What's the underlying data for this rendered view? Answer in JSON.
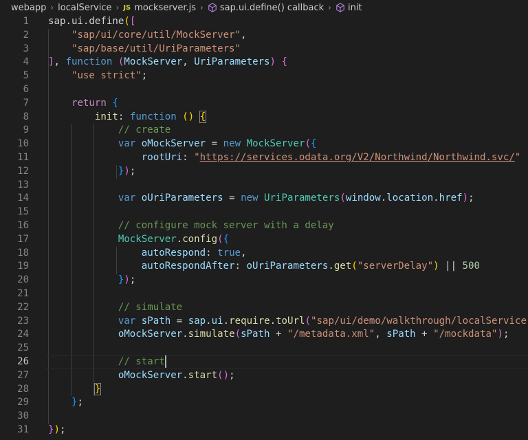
{
  "breadcrumb": {
    "segments": [
      "webapp",
      "localService",
      "mockserver.js",
      "sap.ui.define() callback",
      "init"
    ],
    "file_badge": "JS"
  },
  "editor": {
    "active_line": 26,
    "lines": [
      {
        "n": "1",
        "tokens": [
          [
            "plain",
            "sap.ui.define"
          ],
          [
            "b1",
            "("
          ],
          [
            "b2",
            "["
          ]
        ]
      },
      {
        "n": "2",
        "tokens": [
          [
            "plain",
            "    "
          ],
          [
            "str",
            "\"sap/ui/core/util/MockServer\""
          ],
          [
            "plain",
            ","
          ]
        ]
      },
      {
        "n": "3",
        "tokens": [
          [
            "plain",
            "    "
          ],
          [
            "str",
            "\"sap/base/util/UriParameters\""
          ]
        ]
      },
      {
        "n": "4",
        "tokens": [
          [
            "b2",
            "]"
          ],
          [
            "plain",
            ", "
          ],
          [
            "kw",
            "function"
          ],
          [
            "plain",
            " "
          ],
          [
            "b2",
            "("
          ],
          [
            "var",
            "MockServer"
          ],
          [
            "plain",
            ", "
          ],
          [
            "var",
            "UriParameters"
          ],
          [
            "b2",
            ")"
          ],
          [
            "plain",
            " "
          ],
          [
            "b2",
            "{"
          ]
        ]
      },
      {
        "n": "5",
        "tokens": [
          [
            "plain",
            "    "
          ],
          [
            "str",
            "\"use strict\""
          ],
          [
            "plain",
            ";"
          ]
        ]
      },
      {
        "n": "6",
        "tokens": []
      },
      {
        "n": "7",
        "tokens": [
          [
            "plain",
            "    "
          ],
          [
            "ctrl",
            "return"
          ],
          [
            "plain",
            " "
          ],
          [
            "b3",
            "{"
          ]
        ]
      },
      {
        "n": "8",
        "tokens": [
          [
            "plain",
            "        "
          ],
          [
            "fn",
            "init"
          ],
          [
            "plain",
            ": "
          ],
          [
            "kw",
            "function"
          ],
          [
            "plain",
            " "
          ],
          [
            "b1",
            "()"
          ],
          [
            "plain",
            " "
          ],
          [
            "bm",
            "{"
          ]
        ]
      },
      {
        "n": "9",
        "tokens": [
          [
            "plain",
            "            "
          ],
          [
            "com",
            "// create"
          ]
        ]
      },
      {
        "n": "10",
        "tokens": [
          [
            "plain",
            "            "
          ],
          [
            "kw",
            "var"
          ],
          [
            "plain",
            " "
          ],
          [
            "var",
            "oMockServer"
          ],
          [
            "plain",
            " = "
          ],
          [
            "kw",
            "new"
          ],
          [
            "plain",
            " "
          ],
          [
            "type",
            "MockServer"
          ],
          [
            "b2",
            "("
          ],
          [
            "b3",
            "{"
          ]
        ]
      },
      {
        "n": "11",
        "tokens": [
          [
            "plain",
            "                "
          ],
          [
            "var",
            "rootUri"
          ],
          [
            "plain",
            ": "
          ],
          [
            "str",
            "\""
          ],
          [
            "stru",
            "https://services.odata.org/V2/Northwind/Northwind.svc/"
          ],
          [
            "str",
            "\""
          ]
        ]
      },
      {
        "n": "12",
        "tokens": [
          [
            "plain",
            "            "
          ],
          [
            "b3",
            "}"
          ],
          [
            "b2",
            ")"
          ],
          [
            "plain",
            ";"
          ]
        ]
      },
      {
        "n": "13",
        "tokens": []
      },
      {
        "n": "14",
        "tokens": [
          [
            "plain",
            "            "
          ],
          [
            "kw",
            "var"
          ],
          [
            "plain",
            " "
          ],
          [
            "var",
            "oUriParameters"
          ],
          [
            "plain",
            " = "
          ],
          [
            "kw",
            "new"
          ],
          [
            "plain",
            " "
          ],
          [
            "type",
            "UriParameters"
          ],
          [
            "b2",
            "("
          ],
          [
            "var",
            "window"
          ],
          [
            "plain",
            "."
          ],
          [
            "var",
            "location"
          ],
          [
            "plain",
            "."
          ],
          [
            "var",
            "href"
          ],
          [
            "b2",
            ")"
          ],
          [
            "plain",
            ";"
          ]
        ]
      },
      {
        "n": "15",
        "tokens": []
      },
      {
        "n": "16",
        "tokens": [
          [
            "plain",
            "            "
          ],
          [
            "com",
            "// configure mock server with a delay"
          ]
        ]
      },
      {
        "n": "17",
        "tokens": [
          [
            "plain",
            "            "
          ],
          [
            "type",
            "MockServer"
          ],
          [
            "plain",
            "."
          ],
          [
            "fn",
            "config"
          ],
          [
            "b2",
            "("
          ],
          [
            "b3",
            "{"
          ]
        ]
      },
      {
        "n": "18",
        "tokens": [
          [
            "plain",
            "                "
          ],
          [
            "var",
            "autoRespond"
          ],
          [
            "plain",
            ": "
          ],
          [
            "kw",
            "true"
          ],
          [
            "plain",
            ","
          ]
        ]
      },
      {
        "n": "19",
        "tokens": [
          [
            "plain",
            "                "
          ],
          [
            "var",
            "autoRespondAfter"
          ],
          [
            "plain",
            ": "
          ],
          [
            "var",
            "oUriParameters"
          ],
          [
            "plain",
            "."
          ],
          [
            "fn",
            "get"
          ],
          [
            "b1",
            "("
          ],
          [
            "str",
            "\"serverDelay\""
          ],
          [
            "b1",
            ")"
          ],
          [
            "plain",
            " || "
          ],
          [
            "num",
            "500"
          ]
        ]
      },
      {
        "n": "20",
        "tokens": [
          [
            "plain",
            "            "
          ],
          [
            "b3",
            "}"
          ],
          [
            "b2",
            ")"
          ],
          [
            "plain",
            ";"
          ]
        ]
      },
      {
        "n": "21",
        "tokens": []
      },
      {
        "n": "22",
        "tokens": [
          [
            "plain",
            "            "
          ],
          [
            "com",
            "// simulate"
          ]
        ]
      },
      {
        "n": "23",
        "tokens": [
          [
            "plain",
            "            "
          ],
          [
            "kw",
            "var"
          ],
          [
            "plain",
            " "
          ],
          [
            "var",
            "sPath"
          ],
          [
            "plain",
            " = "
          ],
          [
            "var",
            "sap"
          ],
          [
            "plain",
            "."
          ],
          [
            "var",
            "ui"
          ],
          [
            "plain",
            "."
          ],
          [
            "fn",
            "require"
          ],
          [
            "plain",
            "."
          ],
          [
            "fn",
            "toUrl"
          ],
          [
            "b2",
            "("
          ],
          [
            "str",
            "\"sap/ui/demo/walkthrough/localService\""
          ],
          [
            "b2",
            ")"
          ],
          [
            "plain",
            ";"
          ]
        ]
      },
      {
        "n": "24",
        "tokens": [
          [
            "plain",
            "            "
          ],
          [
            "var",
            "oMockServer"
          ],
          [
            "plain",
            "."
          ],
          [
            "fn",
            "simulate"
          ],
          [
            "b2",
            "("
          ],
          [
            "var",
            "sPath"
          ],
          [
            "plain",
            " + "
          ],
          [
            "str",
            "\"/metadata.xml\""
          ],
          [
            "plain",
            ", "
          ],
          [
            "var",
            "sPath"
          ],
          [
            "plain",
            " + "
          ],
          [
            "str",
            "\"/mockdata\""
          ],
          [
            "b2",
            ")"
          ],
          [
            "plain",
            ";"
          ]
        ]
      },
      {
        "n": "25",
        "tokens": []
      },
      {
        "n": "26",
        "tokens": [
          [
            "plain",
            "            "
          ],
          [
            "com",
            "// start"
          ]
        ]
      },
      {
        "n": "27",
        "tokens": [
          [
            "plain",
            "            "
          ],
          [
            "var",
            "oMockServer"
          ],
          [
            "plain",
            "."
          ],
          [
            "fn",
            "start"
          ],
          [
            "b2",
            "()"
          ],
          [
            "plain",
            ";"
          ]
        ]
      },
      {
        "n": "28",
        "tokens": [
          [
            "plain",
            "        "
          ],
          [
            "bm",
            "}"
          ]
        ]
      },
      {
        "n": "29",
        "tokens": [
          [
            "plain",
            "    "
          ],
          [
            "b3",
            "}"
          ],
          [
            "plain",
            ";"
          ]
        ]
      },
      {
        "n": "30",
        "tokens": []
      },
      {
        "n": "31",
        "tokens": [
          [
            "b2",
            "}"
          ],
          [
            "b1",
            ")"
          ],
          [
            "plain",
            ";"
          ]
        ]
      }
    ]
  }
}
